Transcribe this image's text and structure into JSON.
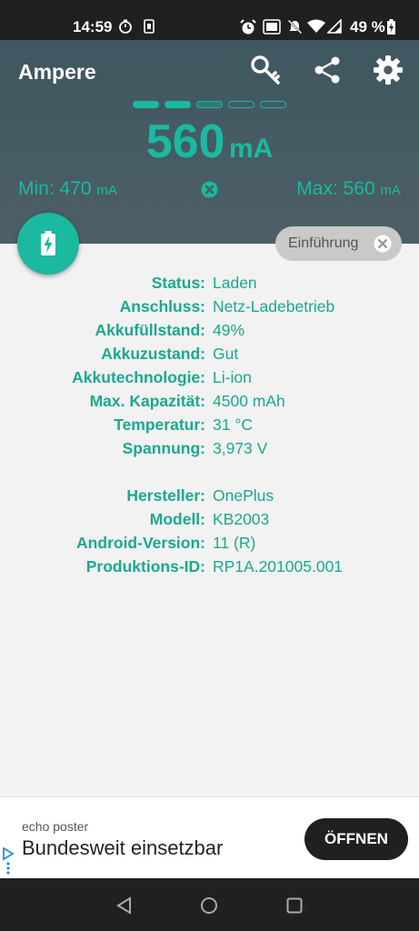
{
  "status_bar": {
    "time": "14:59",
    "battery_percent": "49 %",
    "icons": [
      "timer-icon",
      "sim-icon",
      "alarm-icon",
      "volte-icon",
      "mute-icon",
      "wifi-icon",
      "signal-icon",
      "battery-charging-icon"
    ]
  },
  "header": {
    "title": "Ampere",
    "actions": [
      "key-icon",
      "share-icon",
      "settings-icon"
    ]
  },
  "reading": {
    "value": "560",
    "unit": "mA",
    "min_label": "Min: 470",
    "min_unit": "mA",
    "max_label": "Max: 560",
    "max_unit": "mA",
    "progress_dots_filled": 2,
    "progress_dots_total": 5
  },
  "intro_chip": {
    "label": "Einführung"
  },
  "battery": [
    {
      "key": "Status:",
      "value": "Laden"
    },
    {
      "key": "Anschluss:",
      "value": "Netz-Ladebetrieb"
    },
    {
      "key": "Akkufüllstand:",
      "value": "49%"
    },
    {
      "key": "Akkuzustand:",
      "value": "Gut"
    },
    {
      "key": "Akkutechnologie:",
      "value": "Li-ion"
    },
    {
      "key": "Max. Kapazität:",
      "value": "4500 mAh"
    },
    {
      "key": "Temperatur:",
      "value": "31 °C"
    },
    {
      "key": "Spannung:",
      "value": "3,973 V"
    }
  ],
  "device": [
    {
      "key": "Hersteller:",
      "value": "OnePlus"
    },
    {
      "key": "Modell:",
      "value": "KB2003"
    },
    {
      "key": "Android-Version:",
      "value": "11 (R)"
    },
    {
      "key": "Produktions-ID:",
      "value": "RP1A.201005.001"
    }
  ],
  "ad": {
    "advertiser": "echo poster",
    "headline": "Bundesweit einsetzbar",
    "cta": "ÖFFNEN"
  },
  "colors": {
    "accent": "#1ab9a0",
    "header_bg": "#455a64",
    "status_bar_bg": "#202020"
  }
}
